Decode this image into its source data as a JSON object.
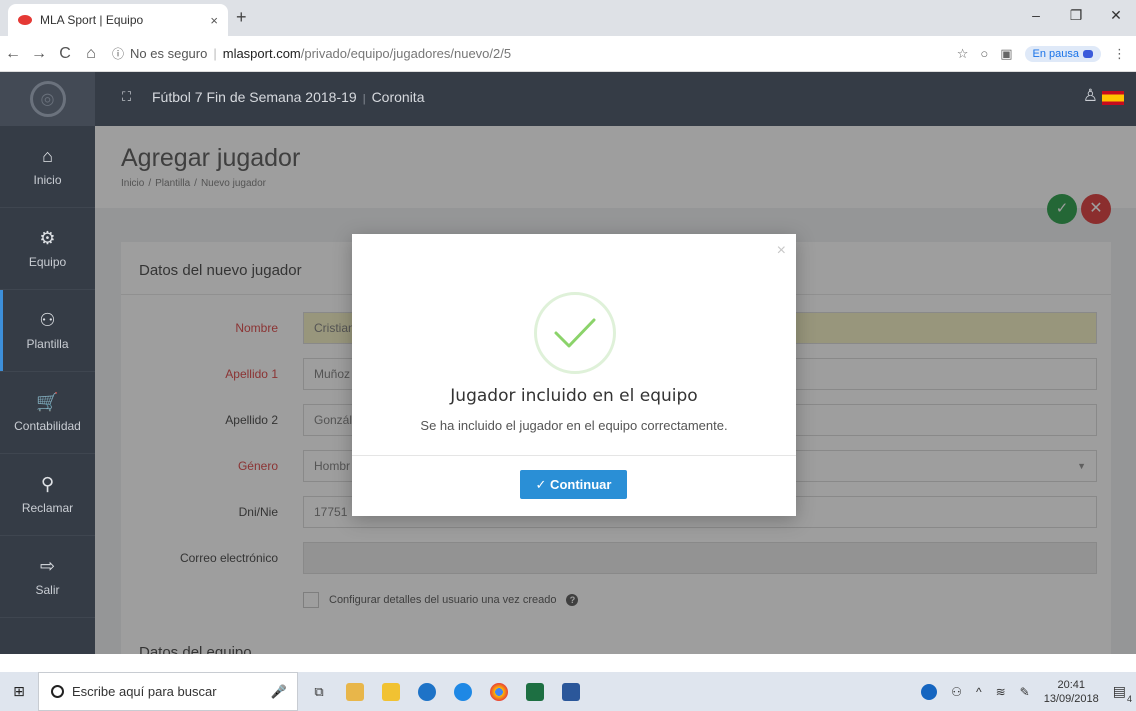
{
  "browser": {
    "tab_title": "MLA Sport | Equipo",
    "tab_close": "×",
    "new_tab": "+",
    "win_minimize": "–",
    "win_restore": "❐",
    "win_close": "✕",
    "back": "←",
    "forward": "→",
    "reload": "C",
    "home": "⌂",
    "info_icon": "ⓘ",
    "security_label": "No es seguro",
    "url_sep": "|",
    "url_host": "mlasport.com",
    "url_path": "/privado/equipo/jugadores/nuevo/2/5",
    "star": "☆",
    "pause_label": "En pausa",
    "menu": "⋮"
  },
  "header": {
    "expand_icon": "⛶",
    "season": "Fútbol 7 Fin de Semana 2018-19",
    "separator": "|",
    "team": "Coronita",
    "user_icon": "♙"
  },
  "sidebar": {
    "items": [
      {
        "icon": "⌂",
        "label": "Inicio"
      },
      {
        "icon": "⚙",
        "label": "Equipo"
      },
      {
        "icon": "⚇",
        "label": "Plantilla"
      },
      {
        "icon": "🛒",
        "label": "Contabilidad"
      },
      {
        "icon": "⚲",
        "label": "Reclamar"
      },
      {
        "icon": "⇨",
        "label": "Salir"
      }
    ]
  },
  "page": {
    "title": "Agregar jugador",
    "breadcrumb": [
      "Inicio",
      "Plantilla",
      "Nuevo jugador"
    ],
    "crumb_sep": "/",
    "ok_icon": "✓",
    "cancel_icon": "✕"
  },
  "form": {
    "section_title": "Datos del nuevo jugador",
    "fields": [
      {
        "label": "Nombre",
        "value": "Cristian"
      },
      {
        "label": "Apellido 1",
        "value": "Muñoz"
      },
      {
        "label": "Apellido 2",
        "value": "Gonzál"
      },
      {
        "label": "Género",
        "value": "Hombr"
      },
      {
        "label": "Dni/Nie",
        "value": "17751"
      },
      {
        "label": "Correo electrónico",
        "value": ""
      }
    ],
    "select_caret": "▼",
    "checkbox_label": "Configurar detalles del usuario una vez creado",
    "help_icon": "?",
    "section2_title": "Datos del equipo"
  },
  "modal": {
    "close": "×",
    "title": "Jugador incluido en el equipo",
    "message": "Se ha incluido el jugador en el equipo correctamente.",
    "button": "✓ Continuar"
  },
  "taskbar": {
    "start_icon": "⊞",
    "search_placeholder": "Escribe aquí para buscar",
    "mic_icon": "🎤",
    "task_view": "⧉",
    "clock_time": "20:41",
    "clock_date": "13/09/2018",
    "notifications": "4"
  }
}
